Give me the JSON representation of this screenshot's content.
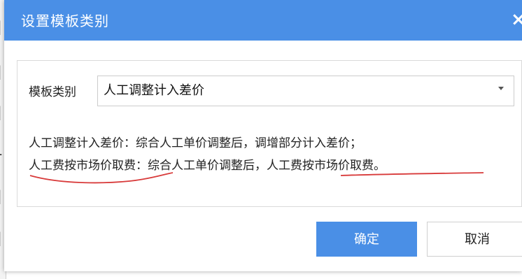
{
  "dialog": {
    "title": "设置模板类别",
    "close_glyph": "×"
  },
  "form": {
    "category_label": "模板类别",
    "category_value": "人工调整计入差价"
  },
  "description": {
    "line1": "人工调整计入差价：综合人工单价调整后，调增部分计入差价；",
    "line2_part1": "人工费按市场价取费",
    "line2_part2": "：综合人工单价调整后，",
    "line2_part3": "人工费按市场价取费。"
  },
  "buttons": {
    "ok_label": "确定",
    "cancel_label": "取消"
  },
  "icons": {
    "close": "close-icon",
    "dropdown": "chevron-down-icon"
  },
  "colors": {
    "titlebar": "#4a8fe6",
    "primary_button": "#4a8fe6",
    "annotation_underline": "#d83a3a"
  }
}
